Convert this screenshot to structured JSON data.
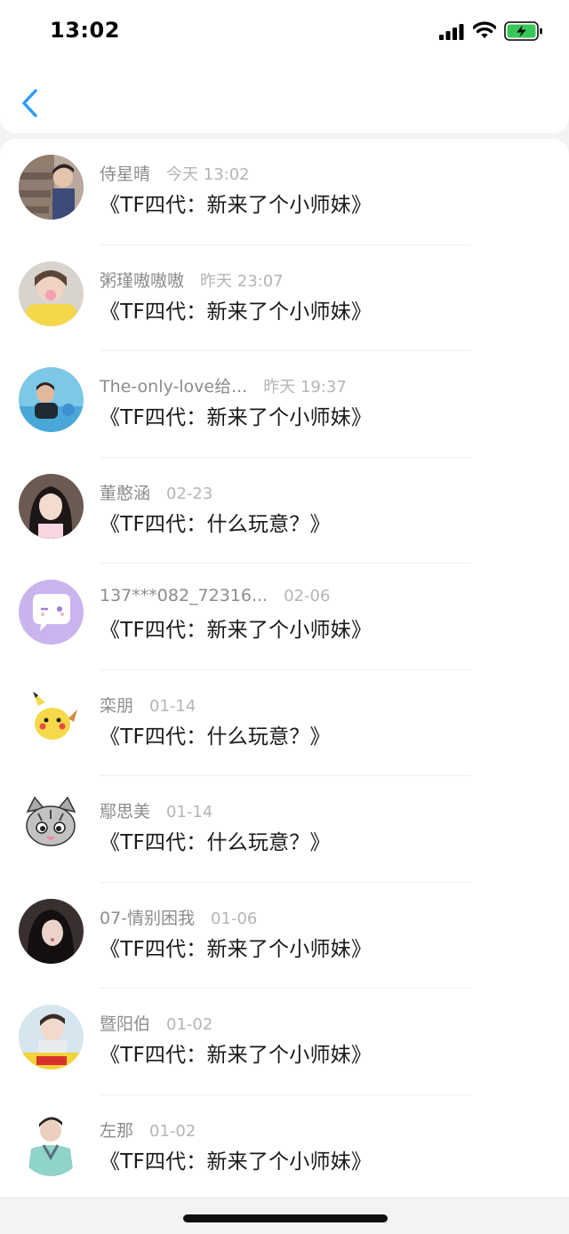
{
  "status_bar": {
    "time": "13:02"
  },
  "header": {
    "back_icon": "chevron-left-icon",
    "accent_color": "#2b9bf4"
  },
  "list": [
    {
      "name": "侍星晴",
      "time": "今天 13:02",
      "message": "《TF四代：新来了个小师妹》",
      "avatar": "photo-boy-on-logs"
    },
    {
      "name": "粥瑾嗷嗷嗷",
      "time": "昨天 23:07",
      "message": "《TF四代：新来了个小师妹》",
      "avatar": "photo-girl-yellow"
    },
    {
      "name": "The-only-love给...",
      "time": "昨天 19:37",
      "message": "《TF四代：新来了个小师妹》",
      "avatar": "photo-swimming"
    },
    {
      "name": "董憨涵",
      "time": "02-23",
      "message": "《TF四代：什么玩意？》",
      "avatar": "photo-girl-dark-hair"
    },
    {
      "name": "137***082_72316...",
      "time": "02-06",
      "message": "《TF四代：新来了个小师妹》",
      "avatar": "default-chat-bubble"
    },
    {
      "name": "栾朋",
      "time": "01-14",
      "message": "《TF四代：什么玩意？》",
      "avatar": "cartoon-pikachu"
    },
    {
      "name": "鄢思美",
      "time": "01-14",
      "message": "《TF四代：什么玩意？》",
      "avatar": "cartoon-cat"
    },
    {
      "name": "07-情别困我",
      "time": "01-06",
      "message": "《TF四代：新来了个小师妹》",
      "avatar": "photo-girl-dark"
    },
    {
      "name": "暨阳伯",
      "time": "01-02",
      "message": "《TF四代：新来了个小师妹》",
      "avatar": "photo-boy-sign"
    },
    {
      "name": "左那",
      "time": "01-02",
      "message": "《TF四代：新来了个小师妹》",
      "avatar": "photo-boy-sweater"
    }
  ]
}
